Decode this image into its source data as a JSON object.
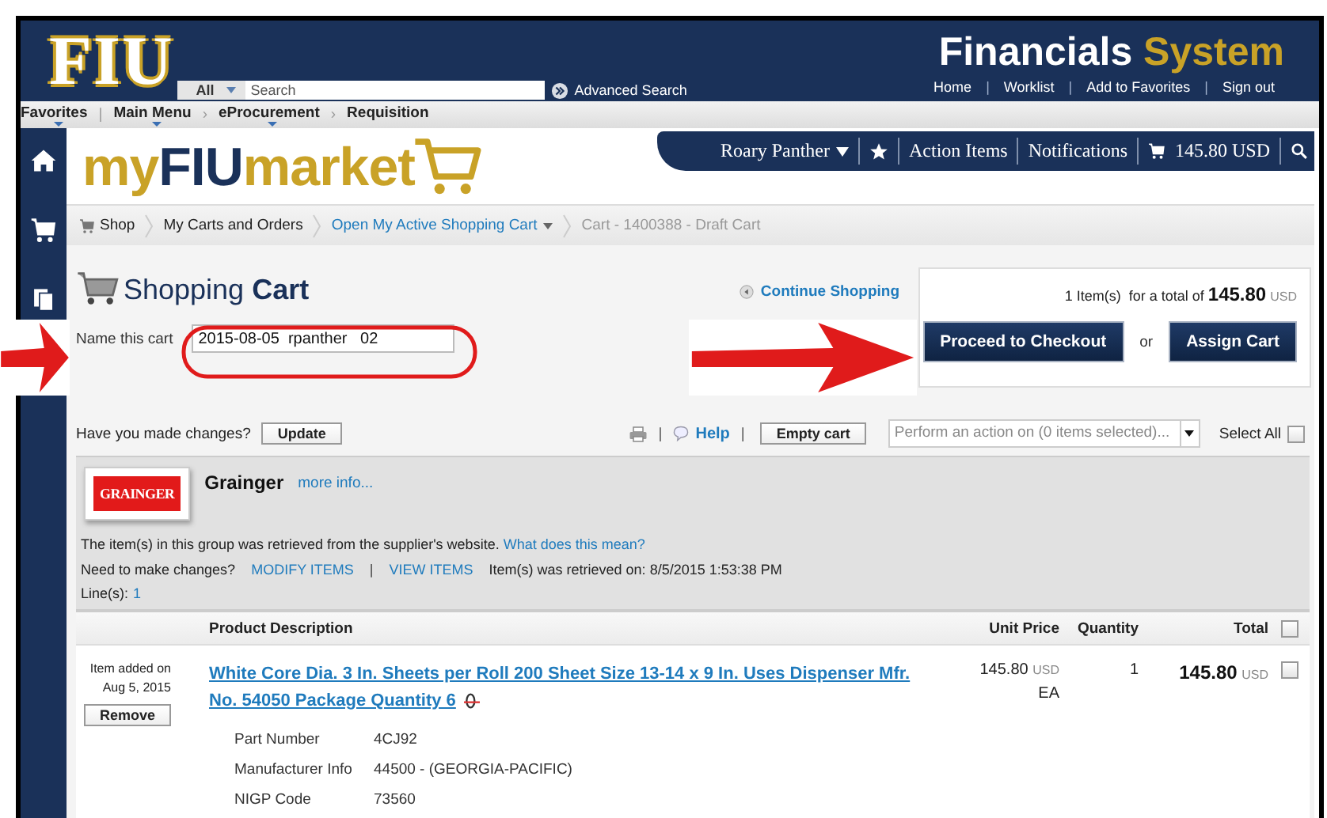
{
  "header": {
    "logo": "FIU",
    "search_scope": "All",
    "search_placeholder": "Search",
    "advanced_search": "Advanced Search",
    "title_primary": "Financials",
    "title_secondary": "System",
    "links": [
      {
        "kind": "link",
        "text": "Home"
      },
      {
        "kind": "separator",
        "text": "|"
      },
      {
        "kind": "link",
        "text": "Worklist"
      },
      {
        "kind": "separator",
        "text": "|"
      },
      {
        "kind": "link",
        "text": "Add to Favorites"
      },
      {
        "kind": "separator",
        "text": "|"
      },
      {
        "kind": "link",
        "text": "Sign out"
      }
    ]
  },
  "nav": [
    {
      "label": "Favorites",
      "menu": true,
      "separator": "|"
    },
    {
      "label": "Main Menu",
      "menu": true,
      "separator": "›"
    },
    {
      "label": "eProcurement",
      "menu": true,
      "separator": "›"
    },
    {
      "label": "Requisition",
      "menu": false
    }
  ],
  "sidebar": [
    {
      "kind": "home"
    },
    {
      "kind": "cart"
    },
    {
      "kind": "documents"
    }
  ],
  "market": {
    "logo_prefix": "my",
    "logo_brand": "FIU",
    "logo_suffix": "market",
    "user": "Roary Panther",
    "action_items": "Action Items",
    "notifications": "Notifications",
    "cart_total": "145.80 USD"
  },
  "breadcrumbs": [
    {
      "label": "Shop",
      "kind": "shop"
    },
    {
      "label": "My Carts and Orders",
      "kind": "plain"
    },
    {
      "label": "Open My Active Shopping Cart",
      "kind": "menu"
    },
    {
      "label": "Cart - 1400388 - Draft Cart",
      "kind": "current"
    }
  ],
  "cart": {
    "title_light": "Shopping",
    "title_bold": "Cart",
    "continue": "Continue Shopping",
    "name_label": "Name this cart",
    "name_value": "2015-08-05  rpanther   02",
    "summary_count": "1 Item(s)",
    "summary_text": "for a total of",
    "summary_total": "145.80",
    "summary_currency": "USD",
    "checkout": "Proceed to Checkout",
    "or": "or",
    "assign": "Assign Cart"
  },
  "toolbar": {
    "changes": "Have you made changes?",
    "update": "Update",
    "separator_1": "|",
    "help": "Help",
    "separator_2": "|",
    "empty": "Empty cart",
    "action_placeholder": "Perform an action on (0 items selected)...",
    "select_all": "Select All",
    "select_all_checked": false
  },
  "supplier": {
    "logo": "GRAINGER",
    "name": "Grainger",
    "more": "more info...",
    "note": "The item(s) in this group was retrieved from the supplier's website.",
    "note_link": "What does this mean?",
    "changes": "Need to make changes?",
    "modify": "MODIFY ITEMS",
    "separator": "|",
    "view": "VIEW ITEMS",
    "retrieved": "Item(s) was retrieved on: 8/5/2015 1:53:38 PM",
    "lines_label": "Line(s):",
    "lines_value": "1"
  },
  "table": {
    "columns": [
      "Product Description",
      "Unit Price",
      "Quantity",
      "Total"
    ],
    "header_checked": false,
    "items": [
      {
        "added_label": "Item added on",
        "added_date": "Aug 5, 2015",
        "remove": "Remove",
        "title": "White Core Dia. 3 In. Sheets per Roll 200 Sheet Size 13-14 x 9 In. Uses Dispenser Mfr. No. 54050 Package Quantity 6",
        "unit_price": "145.80",
        "unit_currency": "USD",
        "unit": "EA",
        "quantity": "1",
        "total": "145.80",
        "total_currency": "USD",
        "checked": false,
        "attributes": [
          {
            "label": "Part Number",
            "value": "4CJ92"
          },
          {
            "label": "Manufacturer Info",
            "value": "44500 - (GEORGIA-PACIFIC)"
          },
          {
            "label": "NIGP Code",
            "value": "73560"
          }
        ]
      }
    ]
  },
  "callouts": [
    {
      "kind": "arrow"
    },
    {
      "kind": "arrow"
    },
    {
      "kind": "ring"
    }
  ]
}
